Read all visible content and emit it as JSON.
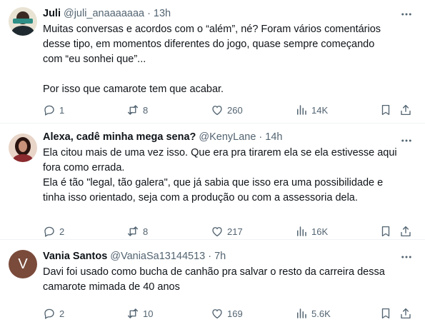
{
  "tweets": [
    {
      "name": "Juli",
      "handle": "@juli_anaaaaaaa",
      "time": "13h",
      "lines": [
        "Muitas conversas e acordos com o “além”, né? Foram vários comentários",
        "desse tipo, em momentos diferentes do jogo, quase sempre começando",
        "com “eu sonhei que”...",
        "",
        "Por isso que camarote tem que acabar."
      ],
      "replies": "1",
      "retweets": "8",
      "likes": "260",
      "views": "14K"
    },
    {
      "name": "Alexa, cadê minha mega sena?",
      "handle": "@KenyLane",
      "time": "14h",
      "lines": [
        "Ela citou mais de uma vez isso. Que era pra tirarem ela se ela estivesse aqui",
        "fora como errada.",
        "Ela é tão \"legal, tão galera\", que já sabia que isso era uma possibilidade e",
        "tinha isso orientado, seja com a produção ou com a assessoria dela."
      ],
      "replies": "2",
      "retweets": "8",
      "likes": "217",
      "views": "16K"
    },
    {
      "name": "Vania Santos",
      "handle": "@VaniaSa13144513",
      "time": "7h",
      "avatar_letter": "V",
      "lines": [
        "Davi foi usado como bucha de canhão pra salvar o resto da carreira dessa",
        "camarote mimada de 40 anos"
      ],
      "replies": "2",
      "retweets": "10",
      "likes": "169",
      "views": "5.6K"
    }
  ],
  "separator": "·",
  "icons": [
    "more-icon",
    "reply-icon",
    "retweet-icon",
    "like-icon",
    "views-icon",
    "bookmark-icon",
    "share-icon"
  ],
  "colors": {
    "text": "#0f1419",
    "muted": "#536471",
    "border": "#eff3f4"
  }
}
